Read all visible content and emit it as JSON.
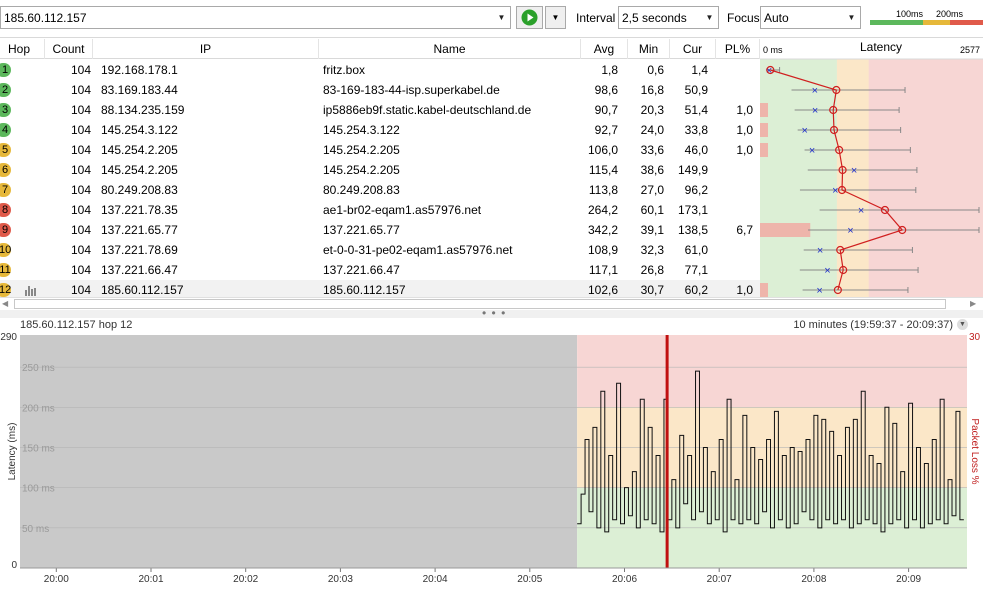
{
  "toolbar": {
    "target_value": "185.60.112.157",
    "interval_label": "Interval",
    "interval_value": "2,5 seconds",
    "focus_label": "Focus",
    "focus_value": "Auto",
    "legend_100": "100ms",
    "legend_200": "200ms",
    "colors": {
      "good": "#5cb85c",
      "warn": "#e6b83a",
      "bad": "#e05a4a",
      "play": "#2aa02a"
    }
  },
  "table": {
    "headers": {
      "hop": "Hop",
      "count": "Count",
      "ip": "IP",
      "name": "Name",
      "avg": "Avg",
      "min": "Min",
      "cur": "Cur",
      "pl": "PL%"
    },
    "rows": [
      {
        "hop": "1",
        "count": "104",
        "ip": "192.168.178.1",
        "name": "fritz.box",
        "avg": "1,8",
        "min": "0,6",
        "cur": "1,4",
        "pl": "",
        "status": "good",
        "avg_ms": 1.8,
        "min_ms": 0.6,
        "cur_ms": 1.4,
        "pl_val": 0
      },
      {
        "hop": "2",
        "count": "104",
        "ip": "83.169.183.44",
        "name": "83-169-183-44-isp.superkabel.de",
        "avg": "98,6",
        "min": "16,8",
        "cur": "50,9",
        "pl": "",
        "status": "good",
        "avg_ms": 98.6,
        "min_ms": 16.8,
        "cur_ms": 50.9,
        "pl_val": 0
      },
      {
        "hop": "3",
        "count": "104",
        "ip": "88.134.235.159",
        "name": "ip5886eb9f.static.kabel-deutschland.de",
        "avg": "90,7",
        "min": "20,3",
        "cur": "51,4",
        "pl": "1,0",
        "status": "good",
        "avg_ms": 90.7,
        "min_ms": 20.3,
        "cur_ms": 51.4,
        "pl_val": 1.0
      },
      {
        "hop": "4",
        "count": "104",
        "ip": "145.254.3.122",
        "name": "145.254.3.122",
        "avg": "92,7",
        "min": "24,0",
        "cur": "33,8",
        "pl": "1,0",
        "status": "good",
        "avg_ms": 92.7,
        "min_ms": 24.0,
        "cur_ms": 33.8,
        "pl_val": 1.0
      },
      {
        "hop": "5",
        "count": "104",
        "ip": "145.254.2.205",
        "name": "145.254.2.205",
        "avg": "106,0",
        "min": "33,6",
        "cur": "46,0",
        "pl": "1,0",
        "status": "warn",
        "avg_ms": 106.0,
        "min_ms": 33.6,
        "cur_ms": 46.0,
        "pl_val": 1.0
      },
      {
        "hop": "6",
        "count": "104",
        "ip": "145.254.2.205",
        "name": "145.254.2.205",
        "avg": "115,4",
        "min": "38,6",
        "cur": "149,9",
        "pl": "",
        "status": "warn",
        "avg_ms": 115.4,
        "min_ms": 38.6,
        "cur_ms": 149.9,
        "pl_val": 0
      },
      {
        "hop": "7",
        "count": "104",
        "ip": "80.249.208.83",
        "name": "80.249.208.83",
        "avg": "113,8",
        "min": "27,0",
        "cur": "96,2",
        "pl": "",
        "status": "warn",
        "avg_ms": 113.8,
        "min_ms": 27.0,
        "cur_ms": 96.2,
        "pl_val": 0
      },
      {
        "hop": "8",
        "count": "104",
        "ip": "137.221.78.35",
        "name": "ae1-br02-eqam1.as57976.net",
        "avg": "264,2",
        "min": "60,1",
        "cur": "173,1",
        "pl": "",
        "status": "bad",
        "avg_ms": 264.2,
        "min_ms": 60.1,
        "cur_ms": 173.1,
        "pl_val": 0
      },
      {
        "hop": "9",
        "count": "104",
        "ip": "137.221.65.77",
        "name": "137.221.65.77",
        "avg": "342,2",
        "min": "39,1",
        "cur": "138,5",
        "pl": "6,7",
        "status": "bad",
        "avg_ms": 342.2,
        "min_ms": 39.1,
        "cur_ms": 138.5,
        "pl_val": 6.7
      },
      {
        "hop": "10",
        "count": "104",
        "ip": "137.221.78.69",
        "name": "et-0-0-31-pe02-eqam1.as57976.net",
        "avg": "108,9",
        "min": "32,3",
        "cur": "61,0",
        "pl": "",
        "status": "warn",
        "avg_ms": 108.9,
        "min_ms": 32.3,
        "cur_ms": 61.0,
        "pl_val": 0
      },
      {
        "hop": "11",
        "count": "104",
        "ip": "137.221.66.47",
        "name": "137.221.66.47",
        "avg": "117,1",
        "min": "26,8",
        "cur": "77,1",
        "pl": "",
        "status": "warn",
        "avg_ms": 117.1,
        "min_ms": 26.8,
        "cur_ms": 77.1,
        "pl_val": 0
      },
      {
        "hop": "12",
        "count": "104",
        "ip": "185.60.112.157",
        "name": "185.60.112.157",
        "avg": "102,6",
        "min": "30,7",
        "cur": "60,2",
        "pl": "1,0",
        "status": "warn",
        "avg_ms": 102.6,
        "min_ms": 30.7,
        "cur_ms": 60.2,
        "pl_val": 1.0
      }
    ]
  },
  "latency_column": {
    "min_label": "0 ms",
    "title": "Latency",
    "max_label": "2577",
    "max_ms": 2577
  },
  "graph": {
    "header_left": "185.60.112.157 hop 12",
    "header_right": "10 minutes (19:59:37 - 20:09:37)",
    "ylabel": "Latency (ms)",
    "y2label": "Packet Loss %",
    "y_top_label": "290",
    "y_zero_label": "0",
    "y2_top_label": "30",
    "grid_labels": [
      "250 ms",
      "200 ms",
      "150 ms",
      "100 ms",
      "50 ms"
    ],
    "x_labels": [
      "20:00",
      "20:01",
      "20:02",
      "20:03",
      "20:04",
      "20:05",
      "20:06",
      "20:07",
      "20:08",
      "20:09"
    ]
  },
  "chart_data": {
    "type": "line",
    "title": "185.60.112.157 hop 12",
    "xlabel": "",
    "ylabel": "Latency (ms)",
    "y2label": "Packet Loss %",
    "ylim": [
      0,
      290
    ],
    "y2lim": [
      0,
      30
    ],
    "x_range": [
      "19:59:37",
      "20:09:37"
    ],
    "x_ticks": [
      "20:00",
      "20:01",
      "20:02",
      "20:03",
      "20:04",
      "20:05",
      "20:06",
      "20:07",
      "20:08",
      "20:09"
    ],
    "zones_ms": {
      "good_max": 100,
      "warn_max": 200
    },
    "data_start_time": "20:05:30",
    "sample_interval_s": 2.5,
    "packet_loss_marker_time": "20:06:27",
    "series": [
      {
        "name": "185.60.112.157",
        "values": [
          55,
          92,
          160,
          70,
          175,
          50,
          220,
          45,
          140,
          60,
          230,
          55,
          100,
          65,
          120,
          50,
          210,
          60,
          175,
          55,
          140,
          45,
          210,
          60,
          110,
          50,
          165,
          80,
          140,
          60,
          245,
          70,
          150,
          55,
          120,
          60,
          160,
          45,
          210,
          60,
          110,
          55,
          190,
          60,
          150,
          55,
          135,
          70,
          160,
          50,
          195,
          60,
          140,
          50,
          150,
          55,
          145,
          70,
          160,
          60,
          190,
          50,
          185,
          60,
          170,
          55,
          140,
          60,
          175,
          50,
          185,
          55,
          220,
          60,
          140,
          55,
          130,
          45,
          200,
          55,
          180,
          60,
          120,
          50,
          205,
          60,
          150,
          50,
          130,
          55,
          160,
          60,
          210,
          55,
          110,
          65,
          195,
          60
        ]
      }
    ]
  }
}
